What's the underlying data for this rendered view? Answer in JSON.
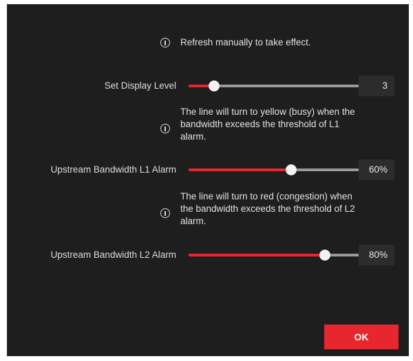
{
  "notices": {
    "refresh": "Refresh manually to take effect.",
    "l1_hint": [
      "The line will turn to yellow (busy) when the",
      "bandwidth exceeds the threshold of L1",
      "alarm."
    ],
    "l2_hint": [
      "The line will turn to red (congestion) when",
      "the bandwidth exceeds the threshold of L2",
      "alarm."
    ]
  },
  "settings": {
    "display_level": {
      "label": "Set Display Level",
      "value": "3",
      "fill_fraction": 0.15
    },
    "l1_alarm": {
      "label": "Upstream Bandwidth L1 Alarm",
      "value": "60%",
      "fill_fraction": 0.6
    },
    "l2_alarm": {
      "label": "Upstream Bandwidth L2 Alarm",
      "value": "80%",
      "fill_fraction": 0.8
    }
  },
  "footer": {
    "ok_label": "OK"
  },
  "colors": {
    "accent": "#e8262e",
    "panel": "#1e1e1e",
    "track": "#9a9a9a"
  },
  "icons": {
    "info": "info-circle-icon"
  }
}
